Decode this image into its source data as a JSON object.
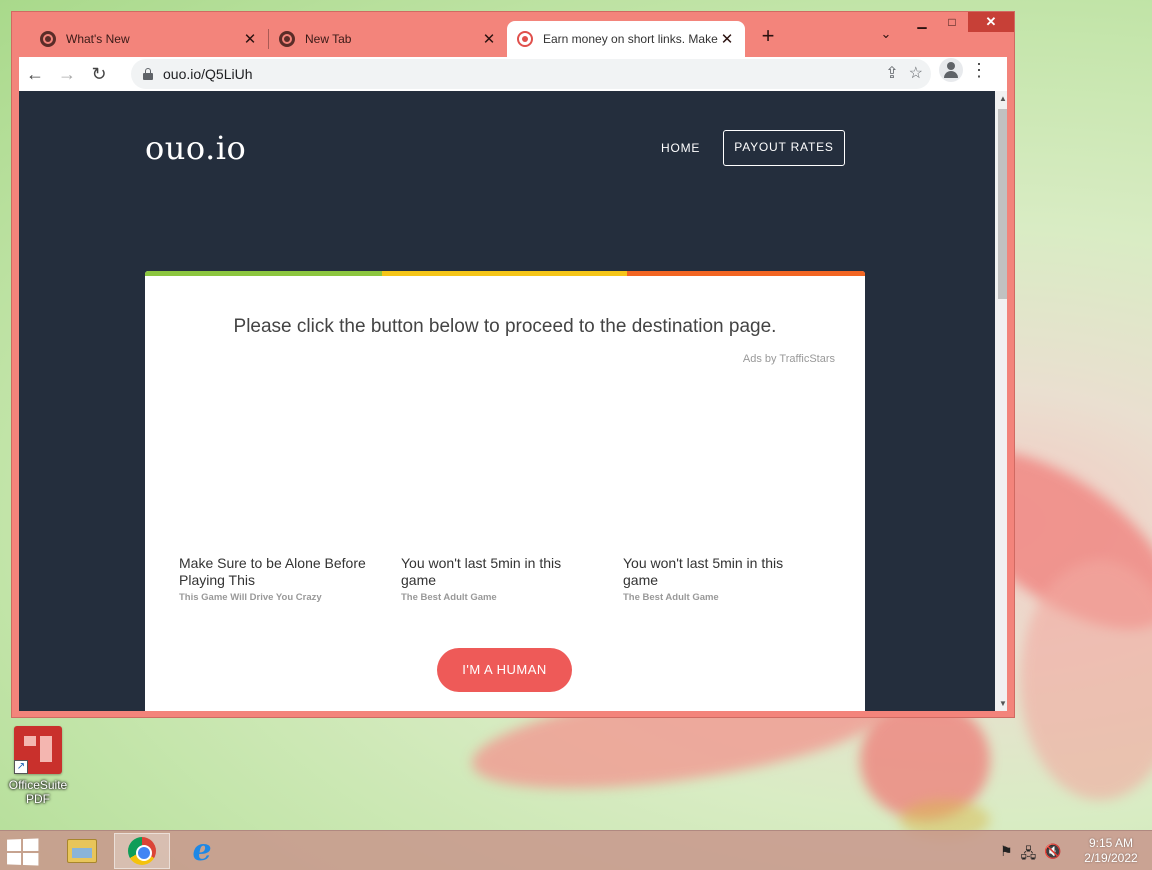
{
  "browser": {
    "tabs": [
      {
        "title": "What's New",
        "icon": "chrome-icon",
        "active": false
      },
      {
        "title": "New Tab",
        "icon": "chrome-icon",
        "active": false
      },
      {
        "title": "Earn money on short links. Make",
        "icon": "ouo-icon",
        "active": true
      }
    ],
    "tab_close_glyph": "✕",
    "new_tab_glyph": "+",
    "tab_menu_glyph": "⌄",
    "window_controls": {
      "minimize": "▁",
      "maximize": "□",
      "close": "✕"
    },
    "nav": {
      "back": "←",
      "forward": "→",
      "reload": "↻"
    },
    "address": "ouo.io/Q5LiUh",
    "omni_icons": {
      "share": "⇪",
      "bookmark": "☆"
    },
    "menu_glyph": "⋮"
  },
  "page": {
    "brand": "ouo.io",
    "nav": {
      "home": "HOME",
      "payout": "PAYOUT RATES"
    },
    "prompt": "Please click the button below to proceed to the destination page.",
    "ads_by": "Ads by TrafficStars",
    "ads": [
      {
        "headline": "Make Sure to be Alone Before Playing This",
        "sub": "This Game Will Drive You Crazy"
      },
      {
        "headline": "You won't last 5min in this game",
        "sub": "The Best Adult Game"
      },
      {
        "headline": "You won't last 5min in this game",
        "sub": "The Best Adult Game"
      }
    ],
    "cta": "I'M A HUMAN",
    "accent_colors": {
      "green": "#8cc63f",
      "yellow": "#f5c518",
      "orange": "#f26522",
      "cta": "#ee5a58",
      "header_bg": "#242e3d"
    }
  },
  "desktop": {
    "icon_label": "OfficeSuite PDF",
    "shortcut_glyph": "↗"
  },
  "taskbar": {
    "apps": [
      "file-explorer",
      "google-chrome",
      "internet-explorer"
    ],
    "ie_glyph": "e",
    "tray": {
      "flag": "⚑",
      "network": "🖧",
      "volume": "🔇"
    },
    "time": "9:15 AM",
    "date": "2/19/2022"
  }
}
